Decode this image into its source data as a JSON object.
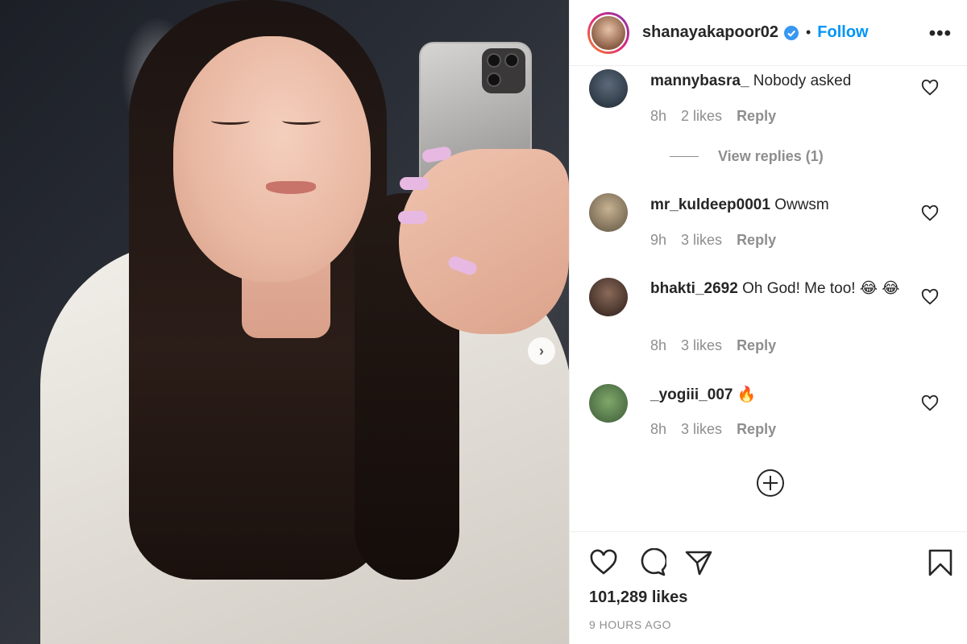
{
  "post": {
    "username": "shanayakapoor02",
    "follow_label": "Follow",
    "separator": "•",
    "more_label": "•••",
    "next_label": "›"
  },
  "comments": [
    {
      "user": "mannybasra_",
      "text": "Nobody asked",
      "time": "8h",
      "likes": "2 likes",
      "reply": "Reply",
      "view_replies": "View replies (1)"
    },
    {
      "user": "mr_kuldeep0001",
      "text": "Owwsm",
      "time": "9h",
      "likes": "3 likes",
      "reply": "Reply"
    },
    {
      "user": "bhakti_2692",
      "text": "Oh God! Me too! 😂 😂",
      "time": "8h",
      "likes": "3 likes",
      "reply": "Reply"
    },
    {
      "user": "_yogiii_007",
      "text": "🔥",
      "time": "8h",
      "likes": "3 likes",
      "reply": "Reply"
    }
  ],
  "footer": {
    "likes": "101,289 likes",
    "time": "9 HOURS AGO"
  },
  "colors": {
    "accent": "#0095f6",
    "verified": "#3897f0",
    "muted": "#8e8e8e"
  },
  "icons": [
    "heart-icon",
    "comment-icon",
    "share-icon",
    "bookmark-icon",
    "plus-circle-icon",
    "verified-icon",
    "chevron-right-icon"
  ]
}
